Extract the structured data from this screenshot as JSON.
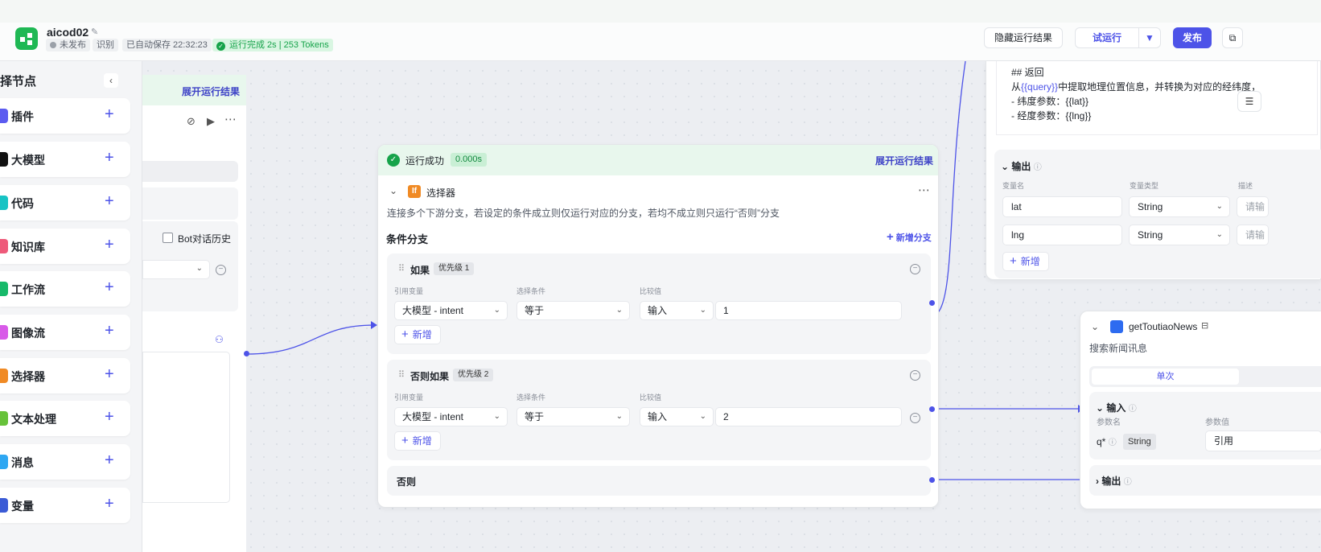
{
  "header": {
    "app_name": "aicod02",
    "status_unpublished": "未发布",
    "tag_recognize": "识别",
    "autosave": "已自动保存 22:32:23",
    "run_status": "运行完成 2s | 253 Tokens",
    "hide_results": "隐藏运行结果",
    "test_run": "试运行",
    "publish": "发布"
  },
  "left_panel": {
    "title": "择节点",
    "items": [
      {
        "label": "插件",
        "color": "#5b5bf0"
      },
      {
        "label": "大模型",
        "color": "#111111"
      },
      {
        "label": "代码",
        "color": "#17c3c4"
      },
      {
        "label": "知识库",
        "color": "#ee5a7a"
      },
      {
        "label": "工作流",
        "color": "#17b96a"
      },
      {
        "label": "图像流",
        "color": "#d85ae8"
      },
      {
        "label": "选择器",
        "color": "#f08a24"
      },
      {
        "label": "文本处理",
        "color": "#67c23a"
      },
      {
        "label": "消息",
        "color": "#2ea7f2"
      },
      {
        "label": "变量",
        "color": "#3b5bd6"
      }
    ]
  },
  "bg_node": {
    "expand_results": "展开运行结果",
    "bot_history": "Bot对话历史"
  },
  "selector_node": {
    "run_success": "运行成功",
    "time": "0.000s",
    "expand_results": "展开运行结果",
    "title": "选择器",
    "description": "连接多个下游分支，若设定的条件成立则仅运行对应的分支，若均不成立则只运行“否则”分支",
    "section_title": "条件分支",
    "add_branch": "新增分支",
    "col_ref": "引用变量",
    "col_cond": "选择条件",
    "col_cmp": "比较值",
    "add": "新增",
    "branches": [
      {
        "title": "如果",
        "priority": "优先级 1",
        "ref": "大模型 - intent",
        "cond": "等于",
        "mode": "输入",
        "value": "1"
      },
      {
        "title": "否则如果",
        "priority": "优先级 2",
        "ref": "大模型 - intent",
        "cond": "等于",
        "mode": "输入",
        "value": "2"
      }
    ],
    "else_label": "否则"
  },
  "right_top_node": {
    "prompt_lines": [
      "## 返回",
      "从{{query}}中提取地理位置信息，并转换为对应的经纬度，",
      "- 纬度参数：{{lat}}",
      "- 经度参数：{{lng}}"
    ],
    "prompt_var": "{{query}}",
    "prompt_pre": "从",
    "prompt_post": "中提取地理位置信息，并转换为对应的经纬度，",
    "output_title": "输出",
    "col_name": "变量名",
    "col_type": "变量类型",
    "col_desc": "描述",
    "rows": [
      {
        "name": "lat",
        "type": "String",
        "desc": "请输"
      },
      {
        "name": "lng",
        "type": "String",
        "desc": "请输"
      }
    ],
    "add": "新增"
  },
  "right_bottom_node": {
    "title": "getToutiaoNews",
    "description": "搜索新闻讯息",
    "tab_single": "单次",
    "input_title": "输入",
    "col_param": "参数名",
    "col_value": "参数值",
    "param_name": "q*",
    "param_type": "String",
    "param_value": "引用",
    "output_title": "输出"
  }
}
